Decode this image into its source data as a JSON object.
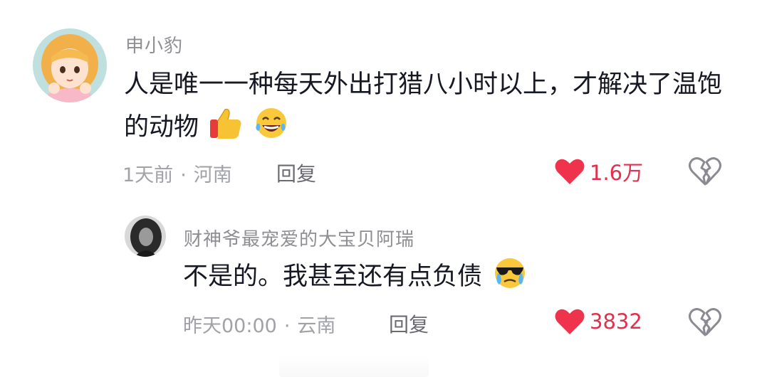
{
  "comments": [
    {
      "username": "申小豹",
      "text_line1": "人是唯一一种每天外出打猎八小时以上，才解决了温饱",
      "text_line2": "的动物",
      "emojis": [
        "thumbs-up-emoji",
        "laughing-tears-emoji"
      ],
      "time": "1天前",
      "location": "河南",
      "reply_label": "回复",
      "like_count": "1.6万"
    },
    {
      "username": "财神爷最宠爱的大宝贝阿瑞",
      "text_line1": "不是的。我甚至还有点负债",
      "emojis": [
        "sunglasses-tears-emoji"
      ],
      "time": "昨天00:00",
      "location": "云南",
      "reply_label": "回复",
      "like_count": "3832"
    }
  ],
  "separator": "·",
  "colors": {
    "like_red": "#e1304c",
    "username_gray": "#8e8e93",
    "text_dark": "#161823",
    "meta_gray": "#a1a1a8"
  }
}
